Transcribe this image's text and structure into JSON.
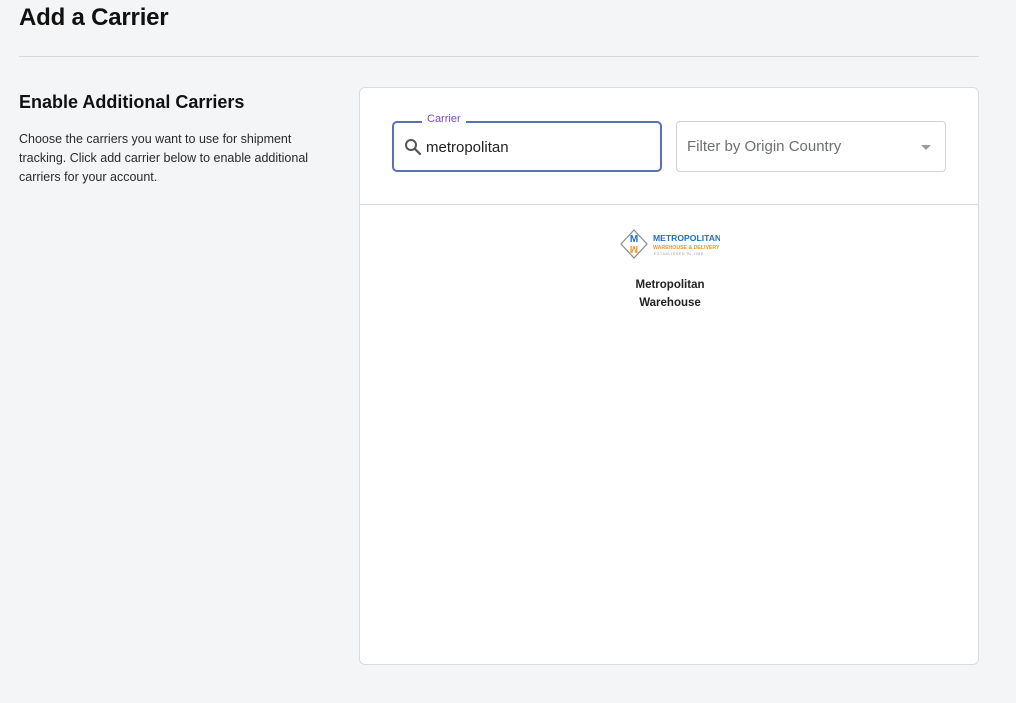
{
  "page": {
    "title": "Add a Carrier"
  },
  "section": {
    "heading": "Enable Additional Carriers",
    "description": "Choose the carriers you want to use for shipment tracking. Click add carrier below to enable additional carriers for your account."
  },
  "filters": {
    "carrier_label": "Carrier",
    "carrier_value": "metropolitan",
    "country_placeholder": "Filter by Origin Country"
  },
  "results": [
    {
      "name": "Metropolitan Warehouse",
      "logo_line1": "METROPOLITAN",
      "logo_line2": "WAREHOUSE & DELIVERY",
      "logo_line3": "ESTABLISHED IN 1988",
      "logo_mark": "MW"
    }
  ],
  "colors": {
    "focus_border": "#5a73b0",
    "label_accent": "#7a4fb8",
    "logo_blue": "#1f6fc4",
    "logo_orange": "#f0962a"
  },
  "icons": {
    "search": "search-icon",
    "dropdown": "caret-down-icon"
  }
}
